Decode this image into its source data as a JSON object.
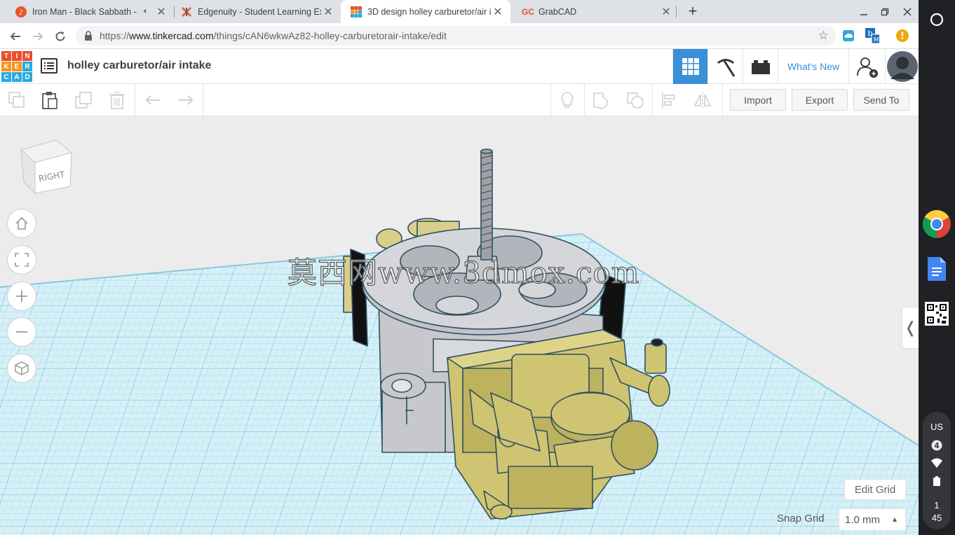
{
  "browser": {
    "tabs": [
      {
        "title": "Iron Man - Black Sabbath - G",
        "icon": "music-icon",
        "audio": true
      },
      {
        "title": "Edgenuity - Student Learning Exp",
        "icon": "edgenuity-icon"
      },
      {
        "title": "3D design holley carburetor/air i",
        "icon": "tinkercad-icon",
        "active": true
      },
      {
        "title": "GrabCAD",
        "icon": "grabcad-icon",
        "favicon_text": "GC"
      }
    ],
    "new_tab_label": "+",
    "url": {
      "scheme": "https://",
      "host": "www.tinkercad.com",
      "path": "/things/cAN6wkwAz82-holley-carburetorair-intake/edit"
    },
    "profile_badge": "!"
  },
  "tinkercad": {
    "logo_letters": [
      "T",
      "I",
      "N",
      "K",
      "E",
      "R",
      "C",
      "A",
      "D"
    ],
    "logo_colors": [
      "#e94e2f",
      "#e94e2f",
      "#e94e2f",
      "#f7941d",
      "#f7941d",
      "#2aa8df",
      "#2aa8df",
      "#2aa8df",
      "#2aa8df"
    ],
    "design_title": "holley carburetor/air intake",
    "whats_new": "What's New",
    "accent_color": "#3a8fd8",
    "actions": {
      "import": "Import",
      "export": "Export",
      "send_to": "Send To"
    },
    "view_cube_label": "RIGHT",
    "watermark": "莫西网www.3dmox.com",
    "edit_grid": "Edit Grid",
    "snap_grid_label": "Snap Grid",
    "snap_grid_value": "1.0 mm",
    "collapse_glyph": "❬"
  },
  "shelf": {
    "status": {
      "keyboard": "US",
      "notifications": "4",
      "time_hour": "1",
      "time_min": "45"
    }
  }
}
